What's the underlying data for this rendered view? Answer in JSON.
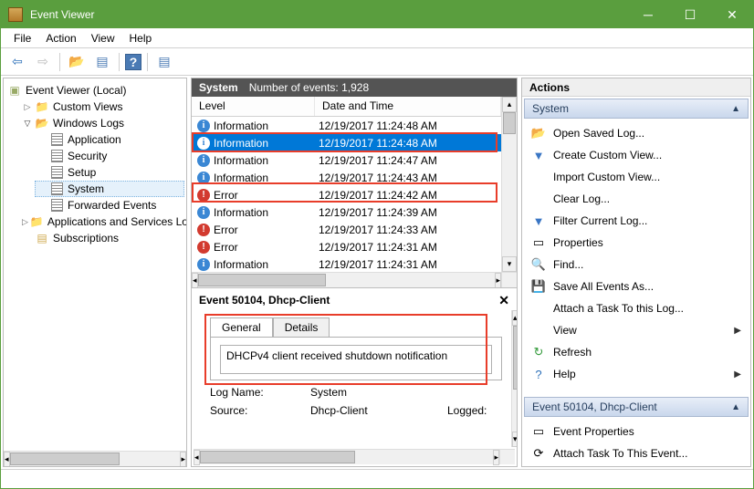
{
  "window": {
    "title": "Event Viewer"
  },
  "menu": [
    "File",
    "Action",
    "View",
    "Help"
  ],
  "tree": {
    "root": "Event Viewer (Local)",
    "custom_views": "Custom Views",
    "windows_logs": "Windows Logs",
    "logs": [
      "Application",
      "Security",
      "Setup",
      "System",
      "Forwarded Events"
    ],
    "apps_services": "Applications and Services Lo",
    "subscriptions": "Subscriptions"
  },
  "center": {
    "header_title": "System",
    "header_count": "Number of events: 1,928",
    "col_level": "Level",
    "col_date": "Date and Time",
    "rows": [
      {
        "type": "info",
        "level": "Information",
        "dt": "12/19/2017 11:24:48 AM",
        "sel": false
      },
      {
        "type": "info",
        "level": "Information",
        "dt": "12/19/2017 11:24:48 AM",
        "sel": true
      },
      {
        "type": "info",
        "level": "Information",
        "dt": "12/19/2017 11:24:47 AM",
        "sel": false
      },
      {
        "type": "info",
        "level": "Information",
        "dt": "12/19/2017 11:24:43 AM",
        "sel": false
      },
      {
        "type": "error",
        "level": "Error",
        "dt": "12/19/2017 11:24:42 AM",
        "sel": false
      },
      {
        "type": "info",
        "level": "Information",
        "dt": "12/19/2017 11:24:39 AM",
        "sel": false
      },
      {
        "type": "error",
        "level": "Error",
        "dt": "12/19/2017 11:24:33 AM",
        "sel": false
      },
      {
        "type": "error",
        "level": "Error",
        "dt": "12/19/2017 11:24:31 AM",
        "sel": false
      },
      {
        "type": "info",
        "level": "Information",
        "dt": "12/19/2017 11:24:31 AM",
        "sel": false
      }
    ],
    "detail_title": "Event 50104, Dhcp-Client",
    "tab_general": "General",
    "tab_details": "Details",
    "detail_body": "DHCPv4 client received shutdown notification",
    "log_name_label": "Log Name:",
    "log_name_value": "System",
    "source_label": "Source:",
    "source_value": "Dhcp-Client",
    "logged_label": "Logged:"
  },
  "actions": {
    "header": "Actions",
    "group1": "System",
    "items1": [
      {
        "icon": "📂",
        "label": "Open Saved Log..."
      },
      {
        "icon": "▼",
        "label": "Create Custom View...",
        "color": "#3a76c4"
      },
      {
        "icon": "",
        "label": "Import Custom View..."
      },
      {
        "icon": "",
        "label": "Clear Log..."
      },
      {
        "icon": "▼",
        "label": "Filter Current Log...",
        "color": "#3a76c4"
      },
      {
        "icon": "▭",
        "label": "Properties"
      },
      {
        "icon": "🔍",
        "label": "Find..."
      },
      {
        "icon": "💾",
        "label": "Save All Events As..."
      },
      {
        "icon": "",
        "label": "Attach a Task To this Log..."
      },
      {
        "icon": "",
        "label": "View",
        "arrow": true
      },
      {
        "icon": "↻",
        "label": "Refresh",
        "color": "#329a3a"
      },
      {
        "icon": "?",
        "label": "Help",
        "color": "#2b6fb8",
        "arrow": true
      }
    ],
    "group2": "Event 50104, Dhcp-Client",
    "items2": [
      {
        "icon": "▭",
        "label": "Event Properties"
      },
      {
        "icon": "⟳",
        "label": "Attach Task To This Event..."
      }
    ]
  }
}
